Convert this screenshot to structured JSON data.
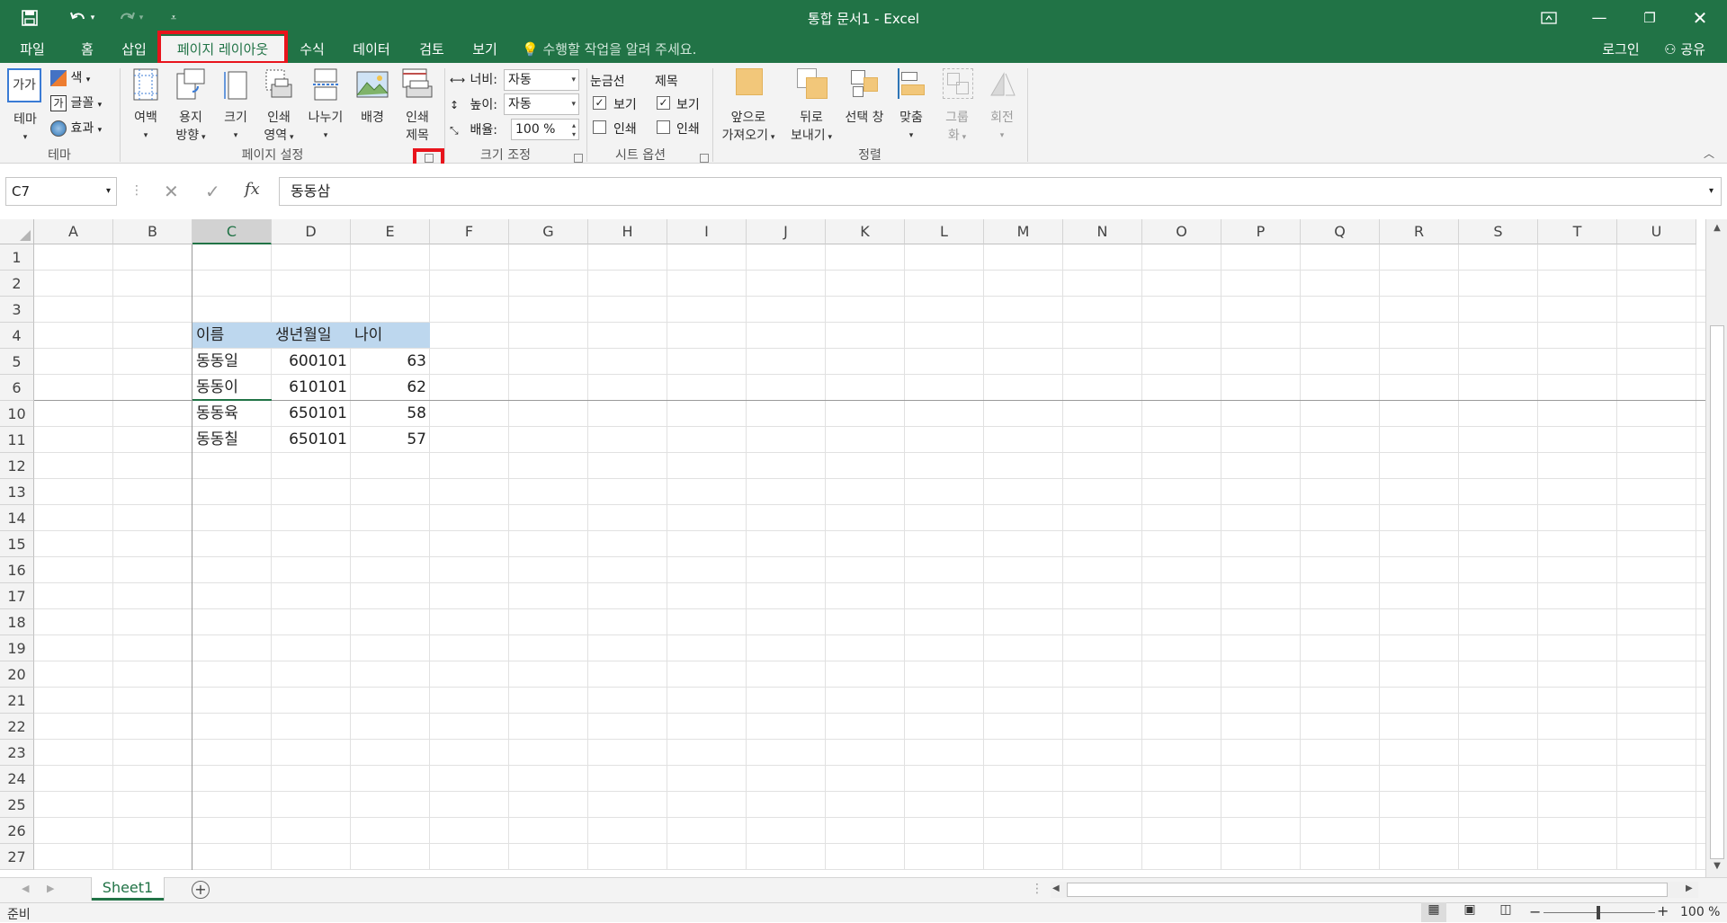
{
  "window": {
    "title": "통합 문서1 - Excel"
  },
  "tabs": [
    "파일",
    "홈",
    "삽입",
    "페이지 레이아웃",
    "수식",
    "데이터",
    "검토",
    "보기"
  ],
  "active_tab": "페이지 레이아웃",
  "tellme": "수행할 작업을 알려 주세요.",
  "login": "로그인",
  "share": "공유",
  "ribbon": {
    "theme": {
      "main": "테마",
      "colors": "색",
      "fonts": "글꼴",
      "effects": "효과",
      "group": "테마",
      "thumb": "가가"
    },
    "page_setup": {
      "margins": "여백",
      "orientation": [
        "용지",
        "방향"
      ],
      "size": "크기",
      "print_area": [
        "인쇄",
        "영역"
      ],
      "breaks": "나누기",
      "background": "배경",
      "print_titles": [
        "인쇄",
        "제목"
      ],
      "group": "페이지 설정"
    },
    "scale": {
      "width_label": "너비:",
      "width_value": "자동",
      "height_label": "높이:",
      "height_value": "자동",
      "scale_label": "배율:",
      "scale_value": "100 %",
      "group": "크기 조정"
    },
    "sheet_options": {
      "gridlines": "눈금선",
      "headings": "제목",
      "view": "보기",
      "print": "인쇄",
      "group": "시트 옵션"
    },
    "arrange": {
      "bring_forward": [
        "앞으로",
        "가져오기"
      ],
      "send_backward": [
        "뒤로",
        "보내기"
      ],
      "selection_pane": "선택 창",
      "align": "맞춤",
      "group_btn": [
        "그룹",
        "화"
      ],
      "rotate": "회전",
      "group": "정렬"
    }
  },
  "formula_bar": {
    "name_box": "C7",
    "content": "동동삼",
    "fx": "fx"
  },
  "columns": [
    "A",
    "B",
    "C",
    "D",
    "E",
    "F",
    "G",
    "H",
    "I",
    "J",
    "K",
    "L",
    "M",
    "N",
    "O",
    "P",
    "Q",
    "R",
    "S",
    "T",
    "U"
  ],
  "rows": [
    "1",
    "2",
    "3",
    "4",
    "5",
    "6",
    "10",
    "11",
    "12",
    "13",
    "14",
    "15",
    "16",
    "17",
    "18",
    "19",
    "20",
    "21",
    "22",
    "23",
    "24",
    "25",
    "26",
    "27"
  ],
  "table": {
    "headers": [
      "이름",
      "생년월일",
      "나이"
    ],
    "rows": [
      [
        "동동일",
        "600101",
        "63"
      ],
      [
        "동동이",
        "610101",
        "62"
      ],
      [
        "동동육",
        "650101",
        "58"
      ],
      [
        "동동칠",
        "650101",
        "57"
      ]
    ]
  },
  "sheet_tab": "Sheet1",
  "status": {
    "ready": "준비",
    "zoom": "100 %"
  },
  "colors": {
    "excel_green": "#217346",
    "highlight_red": "#e8141c",
    "header_fill": "#bdd7ee"
  }
}
